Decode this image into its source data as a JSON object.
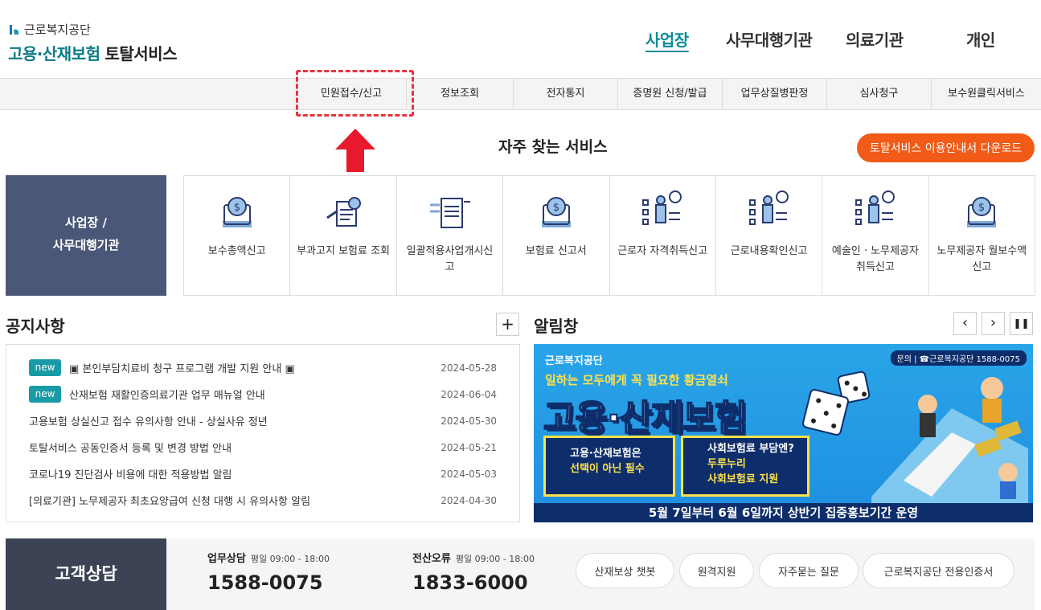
{
  "logo": {
    "org": "근로복지공단",
    "service_a": "고용·산재보험",
    "service_b": "토탈서비스"
  },
  "topnav": [
    "사업장",
    "사무대행기관",
    "의료기관",
    "개인"
  ],
  "subnav": [
    "민원접수/신고",
    "정보조회",
    "전자통지",
    "증명원 신청/발급",
    "업무상질병판정",
    "심사청구",
    "보수원클릭서비스"
  ],
  "favorites": {
    "title": "자주 찾는 서비스",
    "guide_button": "토탈서비스 이용안내서 다운로드",
    "panel_line1": "사업장 /",
    "panel_line2": "사무대행기관",
    "items": [
      {
        "label": "보수총액신고",
        "icon": "money-bag-icon"
      },
      {
        "label": "부과고지 보험료 조회",
        "icon": "document-search-icon"
      },
      {
        "label": "일괄적용사업개시신고",
        "icon": "document-list-icon"
      },
      {
        "label": "보험료 신고서",
        "icon": "money-bag-icon"
      },
      {
        "label": "근로자 자격취득신고",
        "icon": "person-chart-icon"
      },
      {
        "label": "근로내용확인신고",
        "icon": "person-chart-icon"
      },
      {
        "label": "예술인 · 노무제공자 취득신고",
        "icon": "person-chart-icon"
      },
      {
        "label": "노무제공자 월보수액 신고",
        "icon": "money-bag-icon"
      }
    ]
  },
  "notices": {
    "title": "공지사항",
    "more": "+",
    "badge": "new",
    "items": [
      {
        "title": "▣ 본인부담치료비 청구 프로그램 개발 지원 안내 ▣",
        "date": "2024-05-28",
        "new": true
      },
      {
        "title": "산재보험 재활인증의료기관 업무 매뉴얼 안내",
        "date": "2024-06-04",
        "new": true
      },
      {
        "title": "고용보험 상실신고 접수 유의사항 안내 - 상실사유 정년",
        "date": "2024-05-30",
        "new": false
      },
      {
        "title": "토탈서비스 공동인증서 등록 및 변경 방법 안내",
        "date": "2024-05-21",
        "new": false
      },
      {
        "title": "코로나19 진단검사 비용에 대한 적용방법 알림",
        "date": "2024-05-03",
        "new": false
      },
      {
        "title": "[의료기관] 노무제공자 최초요양급여 신청 대행 시 유의사항 알림",
        "date": "2024-04-30",
        "new": false
      }
    ]
  },
  "alarm": {
    "title": "알림창",
    "prev": "‹",
    "next": "›",
    "pause": "❚❚",
    "banner": {
      "logo": "근로복지공단",
      "contact": "문의 | ☎근로복지공단 1588-0075",
      "sub": "일하는 모두에게 꼭 필요한 황금열쇠",
      "main": "고용·산재보험",
      "card1_a": "고용·산재보험은",
      "card1_b": "선택이 아닌 필수",
      "card2_a": "사회보험료 부담엔?",
      "card2_b": "두루누리",
      "card2_c": "사회보험료 지원",
      "bottom": "5월 7일부터 6월 6일까지 상반기 집중홍보기간 운영"
    }
  },
  "footer": {
    "title": "고객상담",
    "work_label": "업무상담",
    "work_hours": "평일 09:00 - 18:00",
    "work_phone": "1588-0075",
    "error_label": "전산오류",
    "error_hours": "평일 09:00 - 18:00",
    "error_phone": "1833-6000",
    "buttons": [
      "산재보상 챗봇",
      "원격지원",
      "자주묻는 질문",
      "근로복지공단 전용인증서"
    ]
  },
  "colors": {
    "teal": "#0c8c98",
    "orange": "#f25a18",
    "panel": "#4b5778",
    "highlight": "#e8343f"
  }
}
